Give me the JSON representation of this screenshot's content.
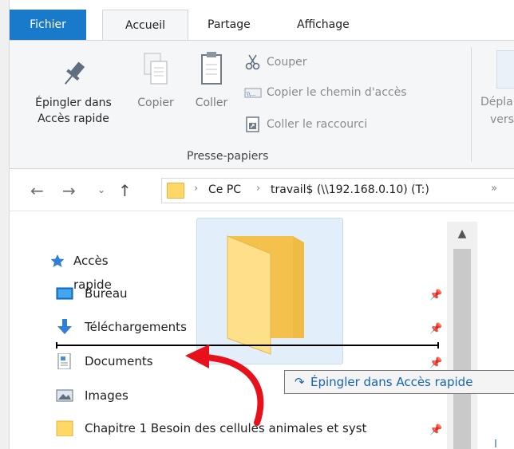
{
  "ribbon": {
    "tabs": [
      "Fichier",
      "Accueil",
      "Partage",
      "Affichage"
    ],
    "pin_label_line1": "Épingler dans",
    "pin_label_line2": "Accès rapide",
    "copy_label": "Copier",
    "paste_label": "Coller",
    "cut_label": "Couper",
    "copy_path_label": "Copier le chemin d'accès",
    "paste_shortcut_label": "Coller le raccourci",
    "group_label": "Presse-papiers",
    "move_label_line1": "Dépla",
    "move_label_line2": "vers"
  },
  "address": {
    "crumbs": [
      "Ce PC",
      "travail$ (\\\\192.168.0.10) (T:)"
    ]
  },
  "nav_pane": {
    "quick_access": "Accès rapide",
    "items": [
      {
        "label": "Bureau",
        "icon": "desktop-icon"
      },
      {
        "label": "Téléchargements",
        "icon": "download-icon"
      },
      {
        "label": "Documents",
        "icon": "document-icon"
      },
      {
        "label": "Images",
        "icon": "images-icon"
      },
      {
        "label": "Chapitre 1 Besoin des cellules animales et syst",
        "icon": "folder-icon"
      }
    ]
  },
  "drag": {
    "tooltip": "Épingler dans Accès rapide"
  },
  "colors": {
    "file_tab": "#1979ca",
    "accent_blue": "#1862b8",
    "annotation_red": "#e8101a",
    "folder_yellow": "#ffd766"
  }
}
